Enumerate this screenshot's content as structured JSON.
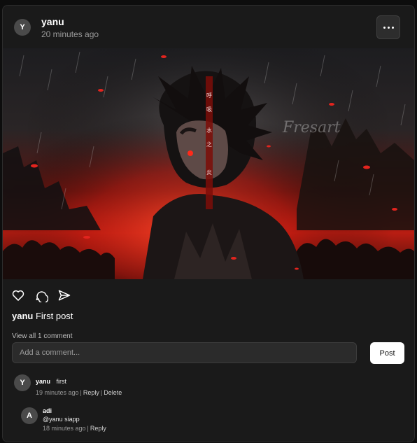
{
  "post": {
    "author": "yanu",
    "avatar_initial": "Y",
    "time": "20 minutes ago",
    "caption_author": "yanu",
    "caption_text": "First post",
    "image_watermark": "Fresart",
    "image_vertical_text": "呼吸 水之 炎",
    "view_comments": "View all 1 comment"
  },
  "comment_box": {
    "placeholder": "Add a comment...",
    "post_label": "Post"
  },
  "comments": [
    {
      "avatar_initial": "Y",
      "author": "yanu",
      "text": "first",
      "time": "19 minutes ago",
      "reply_label": "Reply",
      "delete_label": "Delete"
    },
    {
      "avatar_initial": "A",
      "author": "adi",
      "text": "@yanu siapp",
      "time": "18 minutes ago",
      "reply_label": "Reply"
    }
  ],
  "icons": {
    "more": "ellipsis-icon",
    "like": "heart-icon",
    "comment": "speech-bubble-icon",
    "share": "send-icon"
  },
  "colors": {
    "card_bg": "#1a1a1a",
    "input_bg": "#2b2b2b",
    "accent_red": "#e3241e",
    "post_button_bg": "#ffffff"
  }
}
